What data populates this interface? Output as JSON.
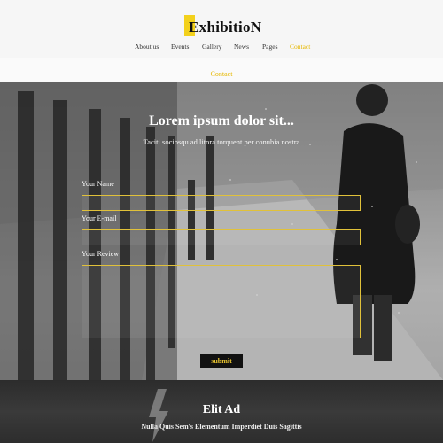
{
  "brand": {
    "logo_text": "ExhibitioN",
    "accent_color": "#f3d11c"
  },
  "nav": {
    "items": [
      {
        "label": "About us",
        "active": false
      },
      {
        "label": "Events",
        "active": false
      },
      {
        "label": "Gallery",
        "active": false
      },
      {
        "label": "News",
        "active": false
      },
      {
        "label": "Pages",
        "active": false
      },
      {
        "label": "Contact",
        "active": true
      }
    ]
  },
  "breadcrumb": {
    "current": "Contact"
  },
  "hero": {
    "title": "Lorem ipsum dolor sit...",
    "subtitle": "Taciti sociosqu ad litora torquent per conubia nostra"
  },
  "form": {
    "name_label": "Your Name",
    "name_value": "",
    "email_label": "Your E-mail",
    "email_value": "",
    "review_label": "Your Review",
    "review_value": "",
    "submit_label": "submit"
  },
  "band": {
    "title": "Elit Ad",
    "subtitle": "Nulla Quis Sem's Elementum Imperdiet Duis Sagittis"
  }
}
